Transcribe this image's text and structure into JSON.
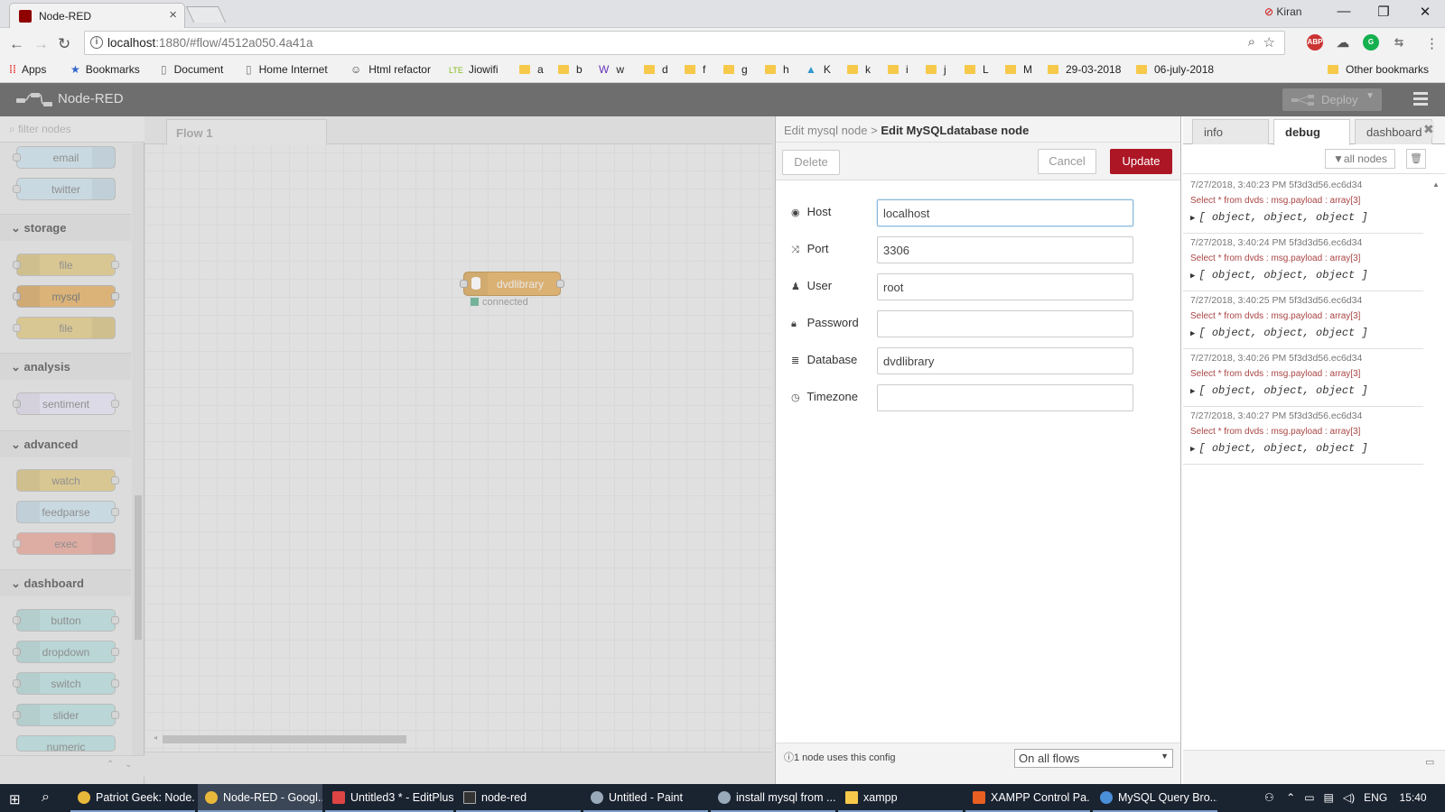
{
  "browser": {
    "tab_title": "Node-RED",
    "user": "Kiran",
    "url_host": "localhost",
    "url_rest": ":1880/#flow/4512a050.4a41a",
    "bookmarks": [
      "Apps",
      "Bookmarks",
      "Document",
      "Home Internet",
      "Html refactor",
      "Jiowifi",
      "a",
      "b",
      "w",
      "d",
      "f",
      "g",
      "h",
      "K",
      "k",
      "i",
      "j",
      "L",
      "M",
      "29-03-2018",
      "06-july-2018",
      "Other bookmarks"
    ]
  },
  "header": {
    "title": "Node-RED",
    "deploy": "Deploy"
  },
  "palette": {
    "filter_placeholder": "filter nodes",
    "social_nodes": [
      "email",
      "twitter"
    ],
    "storage_label": "storage",
    "storage_nodes": [
      "file",
      "mysql",
      "file"
    ],
    "analysis_label": "analysis",
    "analysis_nodes": [
      "sentiment"
    ],
    "advanced_label": "advanced",
    "advanced_nodes": [
      "watch",
      "feedparse",
      "exec"
    ],
    "dashboard_label": "dashboard",
    "dashboard_nodes": [
      "button",
      "dropdown",
      "switch",
      "slider",
      "numeric"
    ]
  },
  "workspace": {
    "tab": "Flow 1",
    "node_label": "dvdlibrary",
    "node_status": "connected"
  },
  "editor": {
    "crumb": "Edit mysql node >",
    "title": "Edit MySQLdatabase node",
    "delete": "Delete",
    "cancel": "Cancel",
    "update": "Update",
    "fields": [
      {
        "label": "Host",
        "icon": "globe-icon",
        "value": "localhost"
      },
      {
        "label": "Port",
        "icon": "random-icon",
        "value": "3306"
      },
      {
        "label": "User",
        "icon": "user-icon",
        "value": "root"
      },
      {
        "label": "Password",
        "icon": "lock-icon",
        "value": ""
      },
      {
        "label": "Database",
        "icon": "database-icon",
        "value": "dvdlibrary"
      },
      {
        "label": "Timezone",
        "icon": "clock-icon",
        "value": ""
      }
    ],
    "footer_note": "1 node uses this config",
    "scope": "On all flows"
  },
  "sidebar": {
    "tabs": [
      "info",
      "debug",
      "dashboard"
    ],
    "filter": "all nodes",
    "messages": [
      {
        "meta": "7/27/2018, 3:40:23 PM  5f3d3d56.ec6d34",
        "topic": "Select * from dvds : msg.payload : array[3]",
        "value": "[ object, object, object ]"
      },
      {
        "meta": "7/27/2018, 3:40:24 PM  5f3d3d56.ec6d34",
        "topic": "Select * from dvds : msg.payload : array[3]",
        "value": "[ object, object, object ]"
      },
      {
        "meta": "7/27/2018, 3:40:25 PM  5f3d3d56.ec6d34",
        "topic": "Select * from dvds : msg.payload : array[3]",
        "value": "[ object, object, object ]"
      },
      {
        "meta": "7/27/2018, 3:40:26 PM  5f3d3d56.ec6d34",
        "topic": "Select * from dvds : msg.payload : array[3]",
        "value": "[ object, object, object ]"
      },
      {
        "meta": "7/27/2018, 3:40:27 PM  5f3d3d56.ec6d34",
        "topic": "Select * from dvds : msg.payload : array[3]",
        "value": "[ object, object, object ]"
      }
    ]
  },
  "taskbar": {
    "items": [
      "Patriot Geek: Node...",
      "Node-RED - Googl...",
      "Untitled3 * - EditPlus",
      "node-red",
      "Untitled - Paint",
      "install mysql from ...",
      "xampp",
      "XAMPP Control Pa...",
      "MySQL Query Bro..."
    ],
    "lang": "ENG",
    "time": "15:40"
  },
  "colors": {
    "update": "#ad1625",
    "header": "#6e6e6e",
    "storage_node": "#e2a853"
  }
}
